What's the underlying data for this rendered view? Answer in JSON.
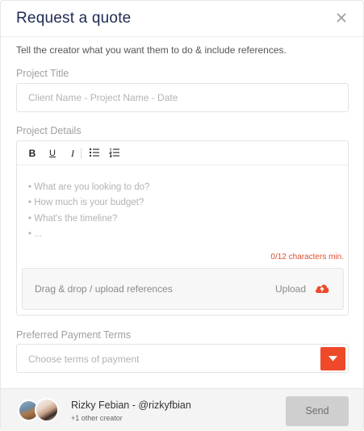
{
  "modal": {
    "title": "Request a quote",
    "intro": "Tell the creator what you want them to do & include references."
  },
  "project_title": {
    "label": "Project Title",
    "placeholder": "Client Name - Project Name - Date",
    "value": ""
  },
  "project_details": {
    "label": "Project Details",
    "toolbar": {
      "bold": "B",
      "underline": "U",
      "italic": "I",
      "bulleted_list_icon": "bulleted-list-icon",
      "numbered_list_icon": "numbered-list-icon"
    },
    "placeholder_lines": [
      "• What are you looking to do?",
      "• How much is your budget?",
      "• What's the timeline?",
      "• ..."
    ],
    "counter": "0/12 characters min."
  },
  "references": {
    "dropzone_label": "Drag & drop / upload references",
    "upload_label": "Upload",
    "upload_icon": "cloud-upload-icon",
    "accent": "#ee4a2a"
  },
  "payment_terms": {
    "label": "Preferred Payment Terms",
    "placeholder": "Choose terms of payment"
  },
  "footer": {
    "creator_name": "Rizky Febian - @rizkyfbian",
    "creator_sub": "+1 other creator",
    "send_label": "Send"
  },
  "colors": {
    "title": "#1f2a52",
    "accent": "#ee4a2a",
    "error": "#e0502f",
    "send_disabled_bg": "#cfcfcf"
  }
}
